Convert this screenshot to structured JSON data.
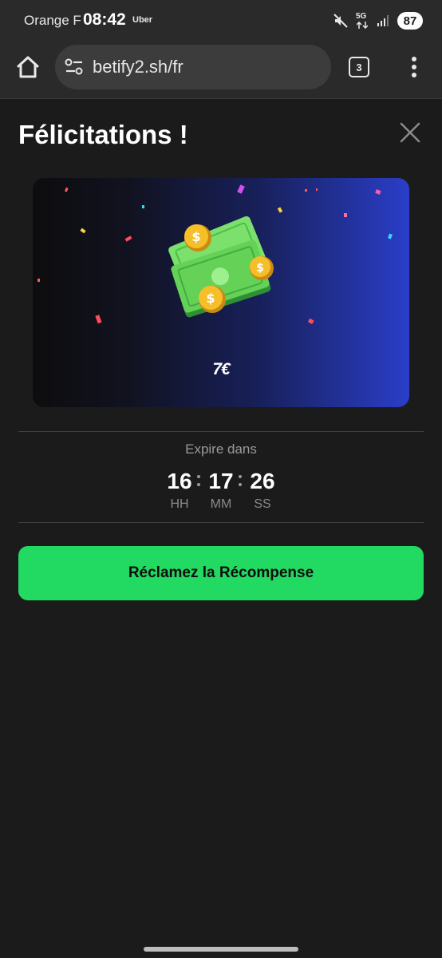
{
  "status_bar": {
    "carrier": "Orange F",
    "time": "08:42",
    "app_indicator": "Uber",
    "network": "5G",
    "battery": "87",
    "icons": [
      "mute-icon",
      "5g-data-icon",
      "signal-icon",
      "battery-icon"
    ]
  },
  "browser": {
    "url": "betify2.sh/fr",
    "tab_count": "3",
    "icons": [
      "home-icon",
      "site-settings-icon",
      "tabs-icon",
      "more-vert-icon"
    ]
  },
  "modal": {
    "title": "Félicitations !",
    "reward_amount": "7€",
    "expire_label": "Expire dans",
    "countdown": {
      "hours": "16",
      "minutes": "17",
      "seconds": "26",
      "hours_label": "HH",
      "minutes_label": "MM",
      "seconds_label": "SS"
    },
    "claim_button": "Réclamez la Récompense",
    "icons": [
      "close-icon",
      "money-cash-coins-illustration",
      "confetti-decoration"
    ]
  },
  "colors": {
    "accent_green": "#22d962",
    "background": "#1b1b1b",
    "banner_blue": "#2a3ec9",
    "coin_gold": "#f2b51f",
    "cash_green": "#5fcf52"
  }
}
